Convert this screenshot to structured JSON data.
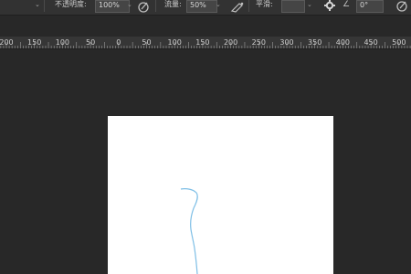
{
  "options_bar": {
    "opacity_label": "不透明度:",
    "opacity_value": "100%",
    "flow_label": "流量:",
    "flow_value": "50%",
    "smoothing_label": "平滑:",
    "angle_value": "0°"
  },
  "ruler": {
    "labels": [
      "200",
      "150",
      "100",
      "50",
      "0",
      "50",
      "100",
      "150",
      "200",
      "250",
      "300",
      "350",
      "400",
      "450",
      "500"
    ]
  },
  "canvas": {
    "background_color": "#ffffff",
    "stroke_color": "#7fbfe6"
  },
  "colors": {
    "app_background": "#282828",
    "options_bar": "#323232",
    "ruler": "#363636"
  }
}
